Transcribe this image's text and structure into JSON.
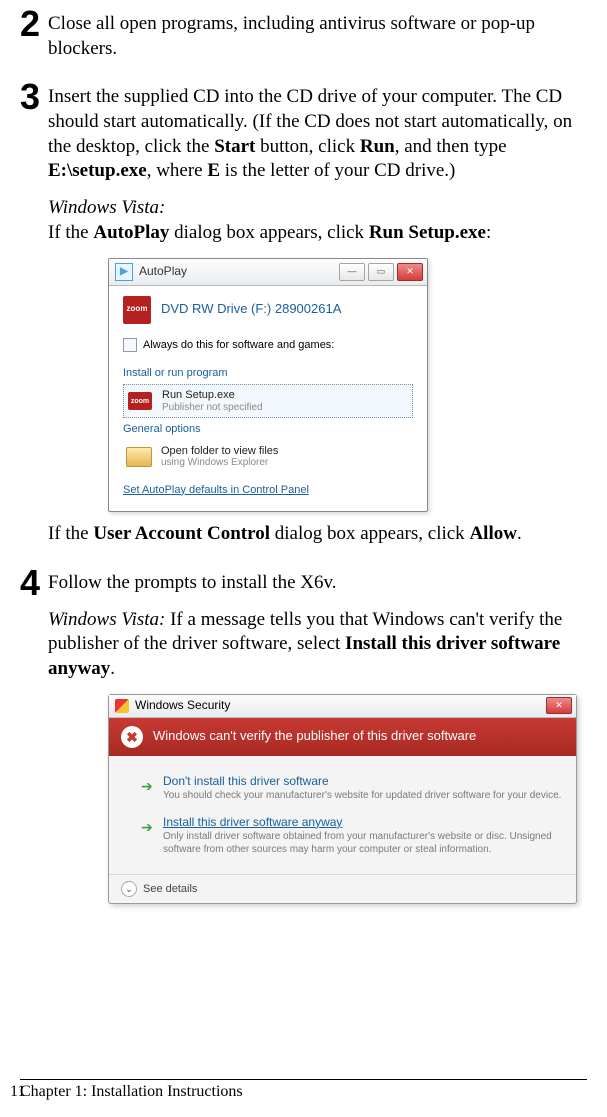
{
  "steps": [
    {
      "num": "2",
      "text": "Close all open programs, including antivirus software or pop-up blockers."
    },
    {
      "num": "3",
      "p1": {
        "a": "Insert the supplied CD into the CD drive of your computer. The CD should start automatically. (If the CD does not start automatically, on the desktop, click the",
        "b1": "Start",
        "c": "button, click",
        "b2": "Run",
        "d": ", and then type",
        "b3": "E:\\setup.exe",
        "e": ", where",
        "b4": "E",
        "f": "is the letter of your CD drive.)"
      },
      "vista_label": "Windows Vista:",
      "vista": {
        "a": "If the",
        "b1": "AutoPlay",
        "c": "dialog box appears, click",
        "b2": "Run Setup.exe",
        "d": ":"
      },
      "uac": {
        "a": "If the",
        "b1": "User Account Control",
        "c": "dialog box appears, click",
        "b2": "Allow",
        "d": "."
      }
    },
    {
      "num": "4",
      "text": "Follow the prompts to install the X6v.",
      "vista_label": "Windows Vista:",
      "vista": {
        "a": "If a message tells you that Windows can't verify the publisher of the driver software, select",
        "b1": "Install this driver software anyway",
        "c": "."
      }
    }
  ],
  "autoplay": {
    "title": "AutoPlay",
    "brand": "zoom",
    "drive": "DVD RW Drive (F:) 28900261A",
    "always": "Always do this for software and games:",
    "sect_install": "Install or run program",
    "run_main": "Run Setup.exe",
    "run_sub": "Publisher not specified",
    "sect_general": "General options",
    "open_main": "Open folder to view files",
    "open_sub": "using Windows Explorer",
    "footer": "Set AutoPlay defaults in Control Panel"
  },
  "security": {
    "title": "Windows Security",
    "heading": "Windows can't verify the publisher of this driver software",
    "opt1": {
      "main": "Don't install this driver software",
      "sub": "You should check your manufacturer's website for updated driver software for your device."
    },
    "opt2": {
      "main": "Install this driver software anyway",
      "sub": "Only install driver software obtained from your manufacturer's website or disc. Unsigned software from other sources may harm your computer or steal information."
    },
    "see_details": "See details"
  },
  "footer": {
    "chapter": "Chapter 1: Installation Instructions",
    "page": "11"
  }
}
